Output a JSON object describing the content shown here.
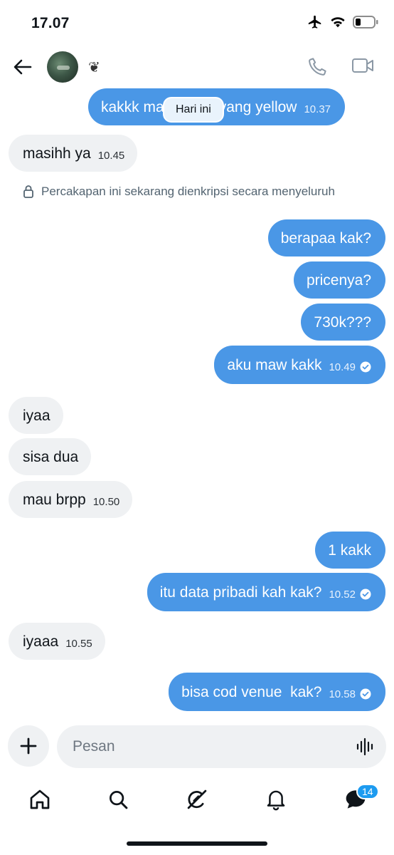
{
  "status_bar": {
    "time": "17.07",
    "icons": [
      "airplane-icon",
      "wifi-icon",
      "battery-icon"
    ]
  },
  "header": {
    "name": "❦",
    "back_icon": "arrow-left-icon",
    "call_icon": "phone-icon",
    "video_icon": "video-icon"
  },
  "chat": {
    "date_divider": "Hari ini",
    "encryption_note": "Percakapan ini sekarang dienkripsi secara menyeluruh",
    "messages": [
      {
        "dir": "out",
        "text": "kakkk masiiihhhh yang yellow",
        "time": "10.37"
      },
      {
        "dir": "in",
        "text": "masihh ya",
        "time": "10.45"
      },
      {
        "dir": "out",
        "text": "berapaa kak?",
        "time": ""
      },
      {
        "dir": "out",
        "text": "pricenya?",
        "time": ""
      },
      {
        "dir": "out",
        "text": "730k???",
        "time": ""
      },
      {
        "dir": "out",
        "text": "aku maw kakk",
        "time": "10.49",
        "read": true
      },
      {
        "dir": "in",
        "text": "iyaa",
        "time": ""
      },
      {
        "dir": "in",
        "text": "sisa dua",
        "time": ""
      },
      {
        "dir": "in",
        "text": "mau brpp",
        "time": "10.50"
      },
      {
        "dir": "out",
        "text": "1 kakk",
        "time": ""
      },
      {
        "dir": "out",
        "text": "itu data pribadi kah kak?",
        "time": "10.52",
        "read": true
      },
      {
        "dir": "in",
        "text": "iyaaa",
        "time": "10.55"
      },
      {
        "dir": "out",
        "text": "bisa cod venue  kak?",
        "time": "10.58",
        "read": true
      }
    ]
  },
  "composer": {
    "placeholder": "Pesan",
    "plus_icon": "plus-icon",
    "voice_icon": "voice-wave-icon"
  },
  "bottom_nav": {
    "items": [
      "home-icon",
      "search-icon",
      "grok-icon",
      "bell-icon",
      "messages-icon"
    ],
    "messages_badge": "14"
  },
  "colors": {
    "accent": "#1d9bf0",
    "outgoing_bubble": "#4a97e6",
    "incoming_bubble": "#eff1f3"
  }
}
